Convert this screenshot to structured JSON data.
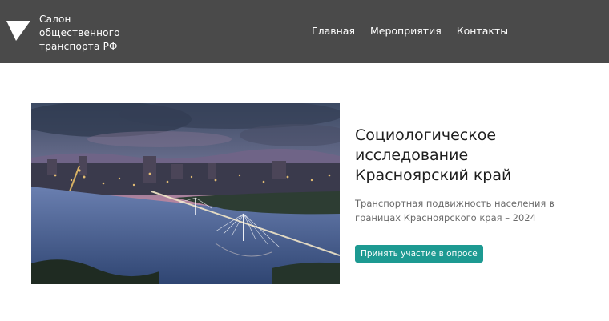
{
  "header": {
    "logo_icon": "white-triangle-logo-icon",
    "brand_lines": [
      "Салон",
      "общественного",
      "транспорта РФ"
    ],
    "nav": [
      "Главная",
      "Мероприятия",
      "Контакты"
    ]
  },
  "hero": {
    "image": "city-bridge-at-dusk",
    "title_lines": [
      "Социологическое",
      "исследование",
      "Красноярский край"
    ],
    "subtitle_lines": [
      "Транспортная подвижность населения в",
      "границах Красноярского края – 2024"
    ],
    "cta_label": "Принять участие в опросе"
  },
  "colors": {
    "header_bg": "#4a4a4a",
    "accent": "#1d9a92",
    "title": "#1e1e1e",
    "subtitle": "#6b6b6b"
  }
}
